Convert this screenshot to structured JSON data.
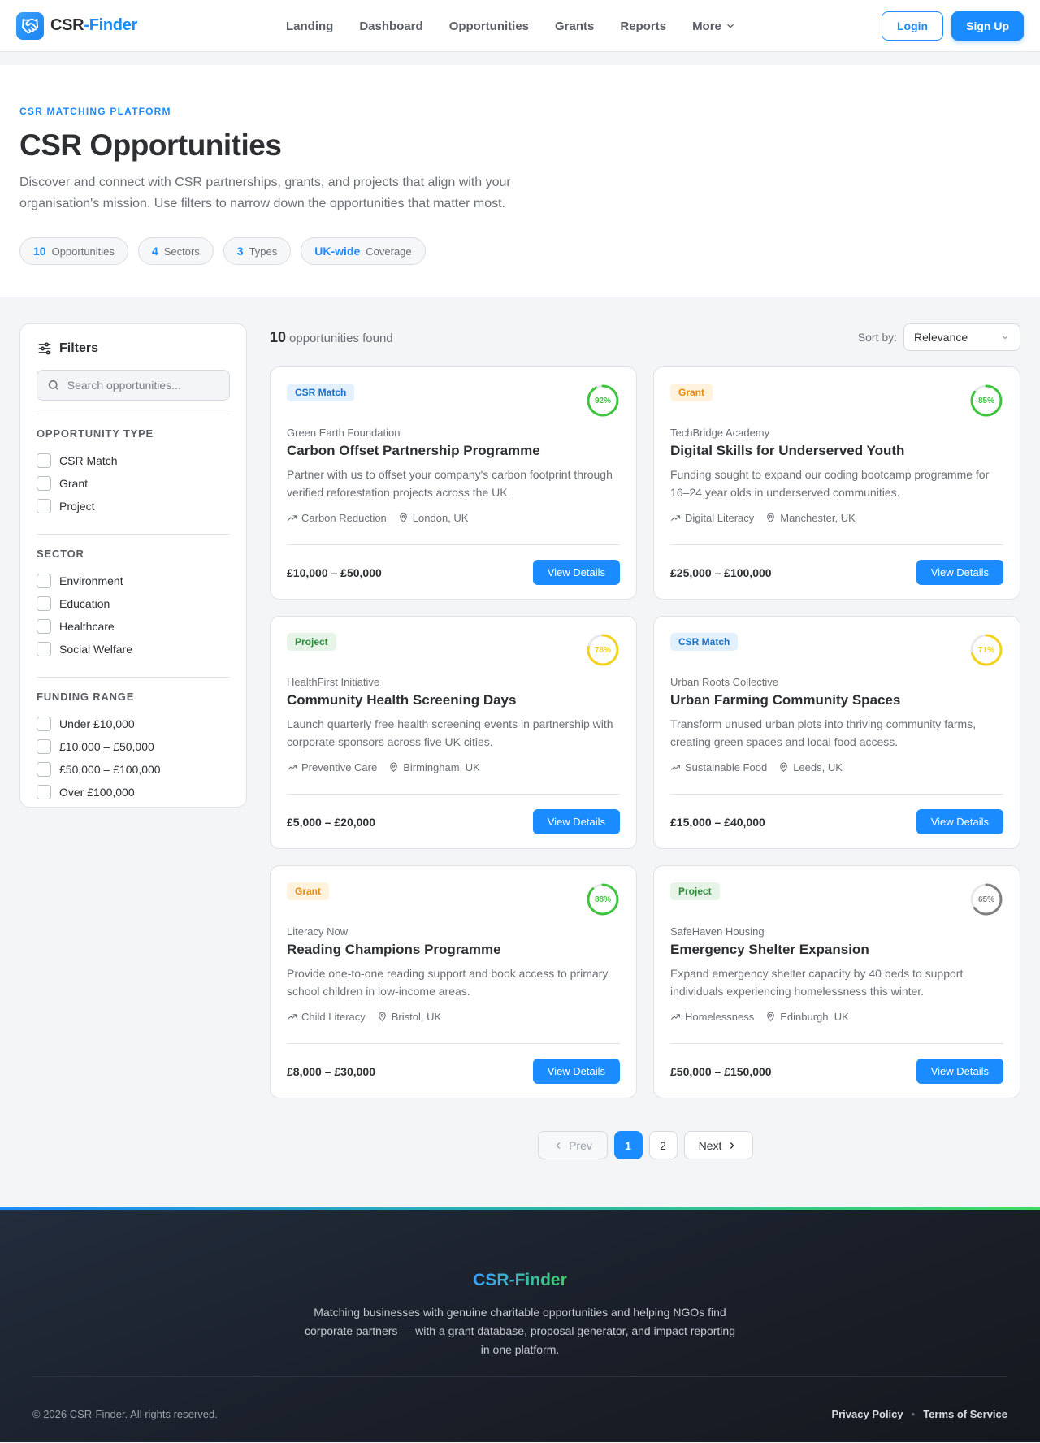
{
  "brand": {
    "part1": "CSR",
    "part2": "-Finder",
    "logo_icon": "handshake-icon"
  },
  "nav": {
    "links": [
      "Landing",
      "Dashboard",
      "Opportunities",
      "Grants",
      "Reports"
    ],
    "more_label": "More",
    "login": "Login",
    "signup": "Sign Up"
  },
  "hero": {
    "eyebrow": "CSR MATCHING PLATFORM",
    "title": "CSR Opportunities",
    "description": "Discover and connect with CSR partnerships, grants, and projects that align with your organisation's mission. Use filters to narrow down the opportunities that matter most.",
    "stats": [
      {
        "value": "10",
        "label": "Opportunities"
      },
      {
        "value": "4",
        "label": "Sectors"
      },
      {
        "value": "3",
        "label": "Types"
      },
      {
        "value": "UK-wide",
        "label": "Coverage"
      }
    ]
  },
  "filters": {
    "title": "Filters",
    "search_placeholder": "Search opportunities...",
    "groups": [
      {
        "title": "OPPORTUNITY TYPE",
        "options": [
          "CSR Match",
          "Grant",
          "Project"
        ]
      },
      {
        "title": "SECTOR",
        "options": [
          "Environment",
          "Education",
          "Healthcare",
          "Social Welfare"
        ]
      },
      {
        "title": "FUNDING RANGE",
        "options": [
          "Under £10,000",
          "£10,000 – £50,000",
          "£50,000 – £100,000",
          "Over £100,000"
        ]
      }
    ]
  },
  "results": {
    "count": "10",
    "count_label": "opportunities found",
    "sort_label": "Sort by:",
    "sort_value": "Relevance"
  },
  "colors": {
    "accent": "#1a8cff",
    "badge_csr_bg": "#e3f0fd",
    "badge_csr_fg": "#1a6fc4",
    "badge_grant_bg": "#fff3de",
    "badge_grant_fg": "#e38a12",
    "badge_project_bg": "#e6f5e8",
    "badge_project_fg": "#2f8a3e",
    "match_high": "#3ec43e",
    "match_mid": "#f2d21b",
    "match_low": "#808080"
  },
  "cards": [
    {
      "type": "CSR Match",
      "type_key": "csr",
      "match": 92,
      "match_label": "92%",
      "org": "Green Earth Foundation",
      "title": "Carbon Offset Partnership Programme",
      "description": "Partner with us to offset your company's carbon footprint through verified reforestation projects across the UK.",
      "focus": "Carbon Reduction",
      "location": "London, UK",
      "amount": "£10,000 – £50,000",
      "cta": "View Details"
    },
    {
      "type": "Grant",
      "type_key": "grant",
      "match": 85,
      "match_label": "85%",
      "org": "TechBridge Academy",
      "title": "Digital Skills for Underserved Youth",
      "description": "Funding sought to expand our coding bootcamp programme for 16–24 year olds in underserved communities.",
      "focus": "Digital Literacy",
      "location": "Manchester, UK",
      "amount": "£25,000 – £100,000",
      "cta": "View Details"
    },
    {
      "type": "Project",
      "type_key": "project",
      "match": 78,
      "match_label": "78%",
      "org": "HealthFirst Initiative",
      "title": "Community Health Screening Days",
      "description": "Launch quarterly free health screening events in partnership with corporate sponsors across five UK cities.",
      "focus": "Preventive Care",
      "location": "Birmingham, UK",
      "amount": "£5,000 – £20,000",
      "cta": "View Details"
    },
    {
      "type": "CSR Match",
      "type_key": "csr",
      "match": 71,
      "match_label": "71%",
      "org": "Urban Roots Collective",
      "title": "Urban Farming Community Spaces",
      "description": "Transform unused urban plots into thriving community farms, creating green spaces and local food access.",
      "focus": "Sustainable Food",
      "location": "Leeds, UK",
      "amount": "£15,000 – £40,000",
      "cta": "View Details"
    },
    {
      "type": "Grant",
      "type_key": "grant",
      "match": 88,
      "match_label": "88%",
      "org": "Literacy Now",
      "title": "Reading Champions Programme",
      "description": "Provide one-to-one reading support and book access to primary school children in low-income areas.",
      "focus": "Child Literacy",
      "location": "Bristol, UK",
      "amount": "£8,000 – £30,000",
      "cta": "View Details"
    },
    {
      "type": "Project",
      "type_key": "project",
      "match": 65,
      "match_label": "65%",
      "org": "SafeHaven Housing",
      "title": "Emergency Shelter Expansion",
      "description": "Expand emergency shelter capacity by 40 beds to support individuals experiencing homelessness this winter.",
      "focus": "Homelessness",
      "location": "Edinburgh, UK",
      "amount": "£50,000 – £150,000",
      "cta": "View Details"
    }
  ],
  "pagination": {
    "prev": "Prev",
    "pages": [
      "1",
      "2"
    ],
    "current": "1",
    "next": "Next"
  },
  "footer": {
    "brand": "CSR-Finder",
    "description": "Matching businesses with genuine charitable opportunities and helping NGOs find corporate partners — with a grant database, proposal generator, and impact reporting in one platform.",
    "copyright": "© 2026 CSR-Finder. All rights reserved.",
    "links": [
      "Privacy Policy",
      "Terms of Service"
    ]
  }
}
